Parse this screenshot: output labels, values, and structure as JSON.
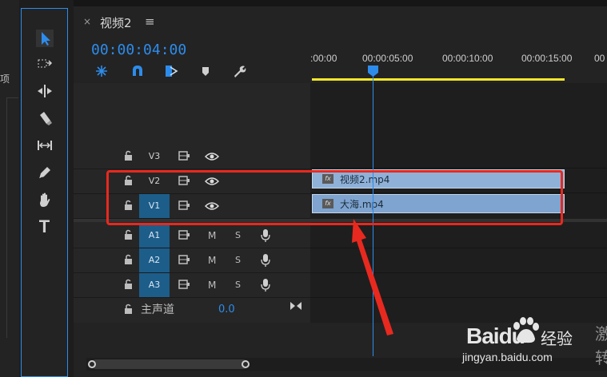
{
  "left_panel": {
    "fragment_text": "项"
  },
  "tools": [
    {
      "name": "selection-tool"
    },
    {
      "name": "track-select-tool"
    },
    {
      "name": "ripple-edit-tool"
    },
    {
      "name": "razor-tool"
    },
    {
      "name": "slip-tool"
    },
    {
      "name": "pen-tool"
    },
    {
      "name": "hand-tool"
    },
    {
      "name": "type-tool",
      "glyph": "T"
    }
  ],
  "sequence": {
    "close_glyph": "×",
    "tab_title": "视频2",
    "menu_glyph": "≡",
    "timecode": "00:00:04:00"
  },
  "header_icons": [
    "snap-icon",
    "magnet-icon",
    "linked-selection-icon",
    "marker-icon",
    "wrench-icon"
  ],
  "ruler": {
    "labels": [
      ":00:00",
      "00:00:05:00",
      "00:00:10:00",
      "00:00:15:00",
      "00"
    ]
  },
  "video_tracks": [
    {
      "name": "V3",
      "selected": false
    },
    {
      "name": "V2",
      "selected": false
    },
    {
      "name": "V1",
      "selected": true
    }
  ],
  "audio_tracks": [
    {
      "name": "A1",
      "m": "M",
      "s": "S",
      "selected": true
    },
    {
      "name": "A2",
      "m": "M",
      "s": "S",
      "selected": true
    },
    {
      "name": "A3",
      "m": "M",
      "s": "S",
      "selected": true
    }
  ],
  "master": {
    "label": "主声道",
    "value": "0.0"
  },
  "clips": [
    {
      "track": "V2",
      "name": "视频2.mp4",
      "fx": "fx"
    },
    {
      "track": "V1",
      "name": "大海.mp4",
      "fx": "fx"
    }
  ],
  "colors": {
    "accent": "#2d8ceb",
    "clip": "#8fb1d8",
    "work_area": "#f1e82a",
    "annotation": "#e8291f"
  },
  "watermark": {
    "brand": "Baidu",
    "brand_cn": "经验",
    "url": "jingyan.baidu.com",
    "side_1": "激",
    "side_2": "转"
  }
}
